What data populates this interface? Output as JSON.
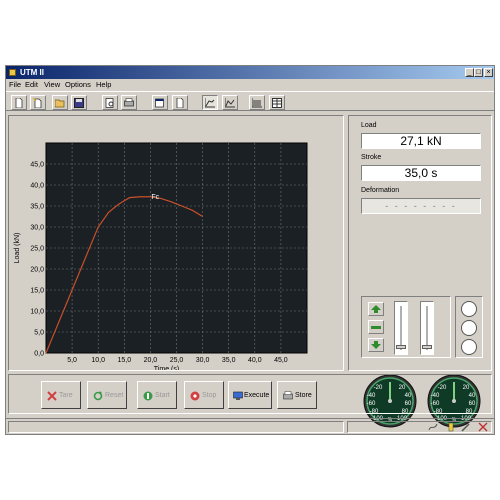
{
  "window": {
    "title": "UTM II"
  },
  "title_buttons": [
    "_",
    "□",
    "×"
  ],
  "menu": [
    "File",
    "Edit",
    "View",
    "Options",
    "Help"
  ],
  "chart_data": {
    "type": "line",
    "title": "",
    "xlabel": "Time (s)",
    "ylabel": "Load (kN)",
    "xlim": [
      0,
      50
    ],
    "ylim": [
      0,
      50
    ],
    "xticks": [
      "5,0",
      "10,0",
      "15,0",
      "20,0",
      "25,0",
      "30,0",
      "35,0",
      "40,0",
      "45,0"
    ],
    "yticks": [
      "0,0",
      "5,0",
      "10,0",
      "15,0",
      "20,0",
      "25,0",
      "30,0",
      "35,0",
      "40,0",
      "45,0"
    ],
    "grid": true,
    "series": [
      {
        "color": "#c8502a",
        "x": [
          0,
          2,
          4,
          6,
          8,
          10,
          12,
          14,
          16,
          18,
          20,
          22,
          24,
          26,
          28,
          30
        ],
        "y": [
          0,
          6,
          12,
          18,
          24,
          30,
          33.5,
          35.5,
          37,
          37.2,
          37.2,
          36.8,
          36,
          35,
          34,
          32.5
        ]
      }
    ],
    "annotation": {
      "text": "Fc",
      "x": 20,
      "y": 37.2
    }
  },
  "meters": {
    "load_label": "Load",
    "load_value": "27,1 kN",
    "stroke_label": "Stroke",
    "stroke_value": "35,0 s",
    "deformation_label": "Deformation",
    "deformation_value": "- - - - - - - -"
  },
  "gauge_ticks": [
    "-20",
    "-40",
    "-60",
    "-80",
    "-100",
    "20",
    "40",
    "60",
    "80",
    "100"
  ],
  "gauge_unit": "%",
  "buttons": {
    "tare": "Tare",
    "reset": "Reset",
    "start": "Start",
    "stop": "Stop",
    "execute": "Execute",
    "store": "Store"
  },
  "colors": {
    "chart_bg": "#1b2024",
    "grid": "#6e7474",
    "curve": "#c8502a",
    "gauge_bg": "#0f3b26",
    "gauge_rim": "#4aa46a"
  }
}
